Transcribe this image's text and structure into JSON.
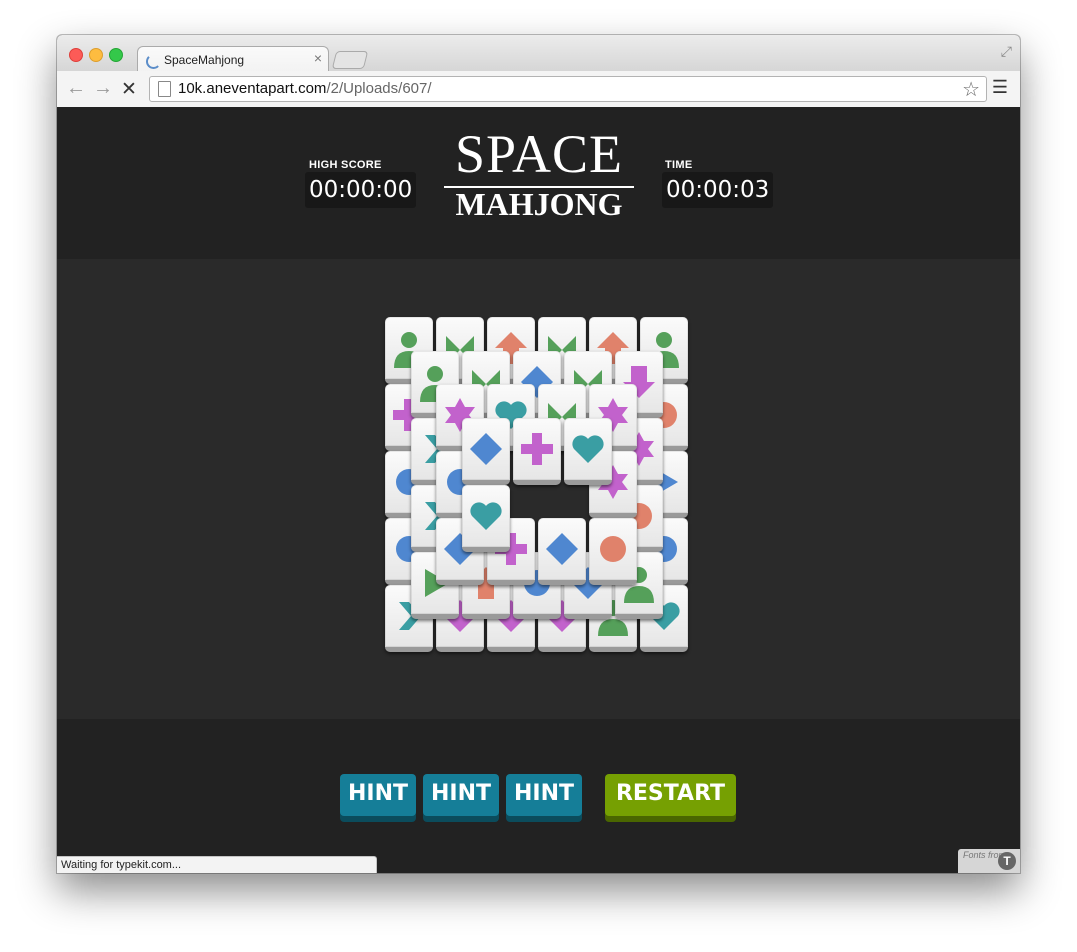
{
  "browser": {
    "tab_title": "SpaceMahjong",
    "tab_close": "×",
    "url_host": "10k.aneventapart.com",
    "url_path": "/2/Uploads/607/",
    "status_text": "Waiting for typekit.com...",
    "typekit_text": "Fonts from",
    "typekit_logo": "T"
  },
  "game": {
    "high_score_label": "HIGH SCORE",
    "high_score_value": "00:00:00",
    "time_label": "TIME",
    "time_value": "00:00:03",
    "logo_top": "SPACE",
    "logo_bottom": "MAHJONG",
    "buttons": {
      "hint1": "HINT",
      "hint2": "HINT",
      "hint3": "HINT",
      "restart": "RESTART"
    }
  },
  "colors": {
    "green": "#55a05a",
    "orange": "#e0826b",
    "blue": "#4f87d0",
    "magenta": "#c262cc",
    "teal": "#3a9ea3",
    "hint_button": "#157e98",
    "restart_button": "#76a002"
  },
  "tiles": [
    {
      "layer": 0,
      "col": 0,
      "row": 0,
      "symbol": "person",
      "color": "green"
    },
    {
      "layer": 0,
      "col": 1,
      "row": 0,
      "symbol": "bowtie",
      "color": "green"
    },
    {
      "layer": 0,
      "col": 2,
      "row": 0,
      "symbol": "arrow-up",
      "color": "orange"
    },
    {
      "layer": 0,
      "col": 3,
      "row": 0,
      "symbol": "bowtie",
      "color": "green"
    },
    {
      "layer": 0,
      "col": 4,
      "row": 0,
      "symbol": "arrow-up",
      "color": "orange"
    },
    {
      "layer": 0,
      "col": 5,
      "row": 0,
      "symbol": "person",
      "color": "green"
    },
    {
      "layer": 0,
      "col": 0,
      "row": 1,
      "symbol": "plus",
      "color": "magenta"
    },
    {
      "layer": 0,
      "col": 5,
      "row": 1,
      "symbol": "circle",
      "color": "orange"
    },
    {
      "layer": 0,
      "col": 0,
      "row": 2,
      "symbol": "circle",
      "color": "blue"
    },
    {
      "layer": 0,
      "col": 5,
      "row": 2,
      "symbol": "arrow-right",
      "color": "blue"
    },
    {
      "layer": 0,
      "col": 0,
      "row": 3,
      "symbol": "circle",
      "color": "blue"
    },
    {
      "layer": 0,
      "col": 5,
      "row": 3,
      "symbol": "circle",
      "color": "blue"
    },
    {
      "layer": 0,
      "col": 0,
      "row": 4,
      "symbol": "chevron",
      "color": "teal"
    },
    {
      "layer": 0,
      "col": 1,
      "row": 4,
      "symbol": "diamond",
      "color": "magenta"
    },
    {
      "layer": 0,
      "col": 2,
      "row": 4,
      "symbol": "diamond",
      "color": "magenta"
    },
    {
      "layer": 0,
      "col": 3,
      "row": 4,
      "symbol": "diamond",
      "color": "magenta"
    },
    {
      "layer": 0,
      "col": 4,
      "row": 4,
      "symbol": "person",
      "color": "green"
    },
    {
      "layer": 0,
      "col": 5,
      "row": 4,
      "symbol": "heart",
      "color": "teal"
    },
    {
      "layer": 1,
      "col": 0,
      "row": 0,
      "symbol": "person",
      "color": "green"
    },
    {
      "layer": 1,
      "col": 1,
      "row": 0,
      "symbol": "bowtie",
      "color": "green"
    },
    {
      "layer": 1,
      "col": 2,
      "row": 0,
      "symbol": "diamond",
      "color": "blue"
    },
    {
      "layer": 1,
      "col": 3,
      "row": 0,
      "symbol": "bowtie",
      "color": "green"
    },
    {
      "layer": 1,
      "col": 4,
      "row": 0,
      "symbol": "arrow-down",
      "color": "magenta"
    },
    {
      "layer": 1,
      "col": 0,
      "row": 1,
      "symbol": "chevron",
      "color": "teal"
    },
    {
      "layer": 1,
      "col": 4,
      "row": 1,
      "symbol": "star",
      "color": "magenta"
    },
    {
      "layer": 1,
      "col": 0,
      "row": 2,
      "symbol": "chevron",
      "color": "teal"
    },
    {
      "layer": 1,
      "col": 4,
      "row": 2,
      "symbol": "circle",
      "color": "orange"
    },
    {
      "layer": 1,
      "col": 0,
      "row": 3,
      "symbol": "arrow-right",
      "color": "green"
    },
    {
      "layer": 1,
      "col": 1,
      "row": 3,
      "symbol": "arrow-up",
      "color": "orange"
    },
    {
      "layer": 1,
      "col": 2,
      "row": 3,
      "symbol": "circle",
      "color": "blue"
    },
    {
      "layer": 1,
      "col": 3,
      "row": 3,
      "symbol": "diamond",
      "color": "blue"
    },
    {
      "layer": 1,
      "col": 4,
      "row": 3,
      "symbol": "person",
      "color": "green"
    },
    {
      "layer": 2,
      "col": 0,
      "row": 0,
      "symbol": "star",
      "color": "magenta"
    },
    {
      "layer": 2,
      "col": 1,
      "row": 0,
      "symbol": "heart",
      "color": "teal"
    },
    {
      "layer": 2,
      "col": 2,
      "row": 0,
      "symbol": "bowtie",
      "color": "green"
    },
    {
      "layer": 2,
      "col": 3,
      "row": 0,
      "symbol": "star",
      "color": "magenta"
    },
    {
      "layer": 2,
      "col": 0,
      "row": 1,
      "symbol": "circle",
      "color": "blue"
    },
    {
      "layer": 2,
      "col": 3,
      "row": 1,
      "symbol": "star",
      "color": "magenta"
    },
    {
      "layer": 2,
      "col": 0,
      "row": 2,
      "symbol": "diamond",
      "color": "blue"
    },
    {
      "layer": 2,
      "col": 1,
      "row": 2,
      "symbol": "plus",
      "color": "magenta"
    },
    {
      "layer": 2,
      "col": 2,
      "row": 2,
      "symbol": "diamond",
      "color": "blue"
    },
    {
      "layer": 2,
      "col": 3,
      "row": 2,
      "symbol": "circle",
      "color": "orange"
    },
    {
      "layer": 3,
      "col": 0,
      "row": 0,
      "symbol": "diamond",
      "color": "blue"
    },
    {
      "layer": 3,
      "col": 1,
      "row": 0,
      "symbol": "plus",
      "color": "magenta"
    },
    {
      "layer": 3,
      "col": 2,
      "row": 0,
      "symbol": "heart",
      "color": "teal"
    },
    {
      "layer": 3,
      "col": 0,
      "row": 1,
      "symbol": "heart",
      "color": "teal"
    }
  ]
}
